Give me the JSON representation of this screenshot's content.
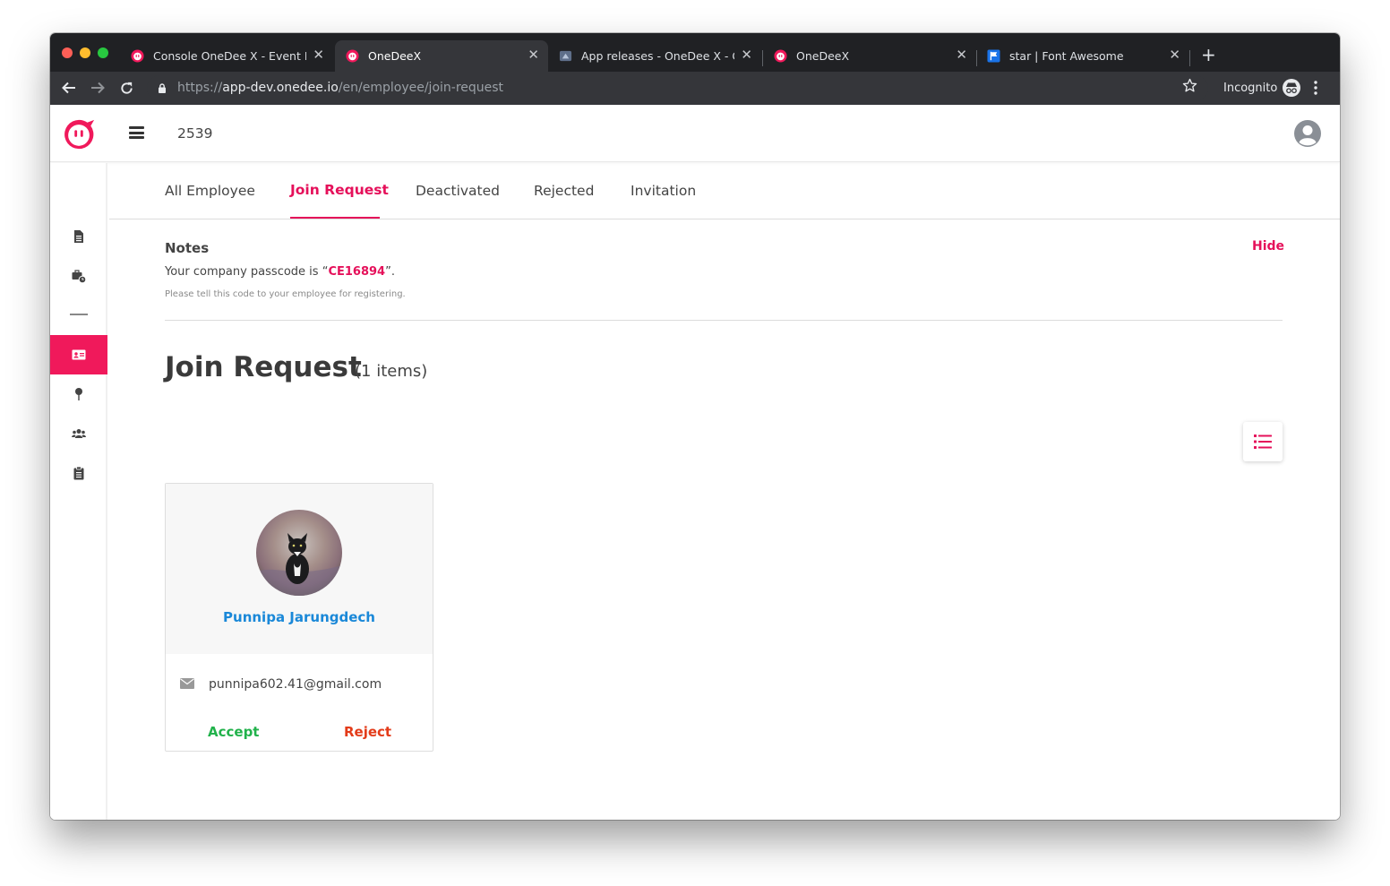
{
  "browser": {
    "tabs": [
      {
        "title": "Console OneDee X - Event Log",
        "favicon": "onedee-logo-icon",
        "active": false
      },
      {
        "title": "OneDeeX",
        "favicon": "onedee-logo-icon",
        "active": true
      },
      {
        "title": "App releases - OneDee X - Google",
        "favicon": "app-releases-icon",
        "active": false
      },
      {
        "title": "OneDeeX",
        "favicon": "onedee-logo-icon",
        "active": false
      },
      {
        "title": "star | Font Awesome",
        "favicon": "font-awesome-flag-icon",
        "active": false
      }
    ],
    "close_glyph": "✕",
    "new_tab_glyph": "+",
    "url_scheme": "https://",
    "url_host": "app-dev.onedee.io",
    "url_path": "/en/employee/join-request",
    "incognito_label": "Incognito"
  },
  "header": {
    "company_id": "2539"
  },
  "sidebar": {
    "items": [
      {
        "icon": "document-icon",
        "active": false
      },
      {
        "icon": "briefcase-clock-icon",
        "active": false
      },
      {
        "icon": "id-card-icon",
        "active": true
      },
      {
        "icon": "map-pin-icon",
        "active": false
      },
      {
        "icon": "users-icon",
        "active": false
      },
      {
        "icon": "clipboard-icon",
        "active": false
      }
    ]
  },
  "page_tabs": [
    {
      "label": "All Employee",
      "active": false
    },
    {
      "label": "Join Request",
      "active": true
    },
    {
      "label": "Deactivated",
      "active": false
    },
    {
      "label": "Rejected",
      "active": false
    },
    {
      "label": "Invitation",
      "active": false
    }
  ],
  "notes": {
    "title": "Notes",
    "hide_label": "Hide",
    "passcode_prefix": "Your company passcode is “",
    "passcode": "CE16894",
    "passcode_suffix": "”.",
    "hint": "Please tell this code to your employee for registering."
  },
  "section": {
    "title": "Join Request",
    "count_text": "(1 items)"
  },
  "requests": [
    {
      "name": "Punnipa Jarungdech",
      "email": "punnipa602.41@gmail.com",
      "accept_label": "Accept",
      "reject_label": "Reject"
    }
  ],
  "colors": {
    "brand": "#f0195b",
    "link_blue": "#1a88d8",
    "accept_green": "#21b24b",
    "reject_red": "#e33b19"
  }
}
